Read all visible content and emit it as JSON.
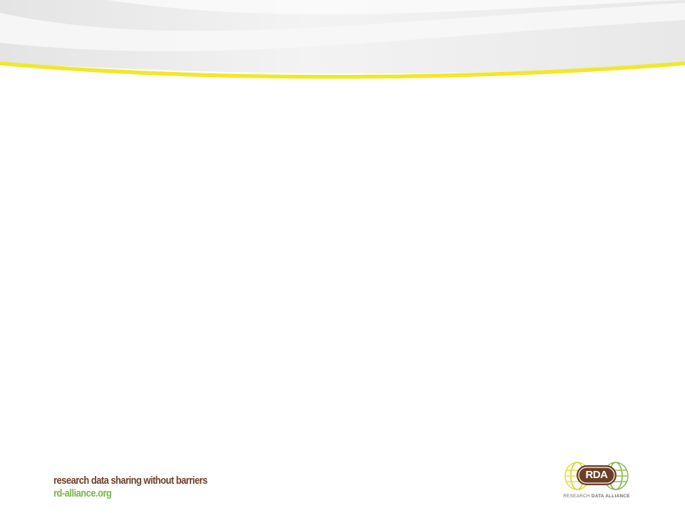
{
  "footer": {
    "tagline": "research data sharing without barriers",
    "url": "rd-alliance.org"
  },
  "logo": {
    "mark": "RDA",
    "caption_part1": "RESEARCH ",
    "caption_part2": "DATA ALLIANCE"
  },
  "colors": {
    "brand_brown": "#6b3f27",
    "brand_green": "#7ab648",
    "accent_yellow": "#f0e82a",
    "caption_grey": "#6d6e71"
  }
}
